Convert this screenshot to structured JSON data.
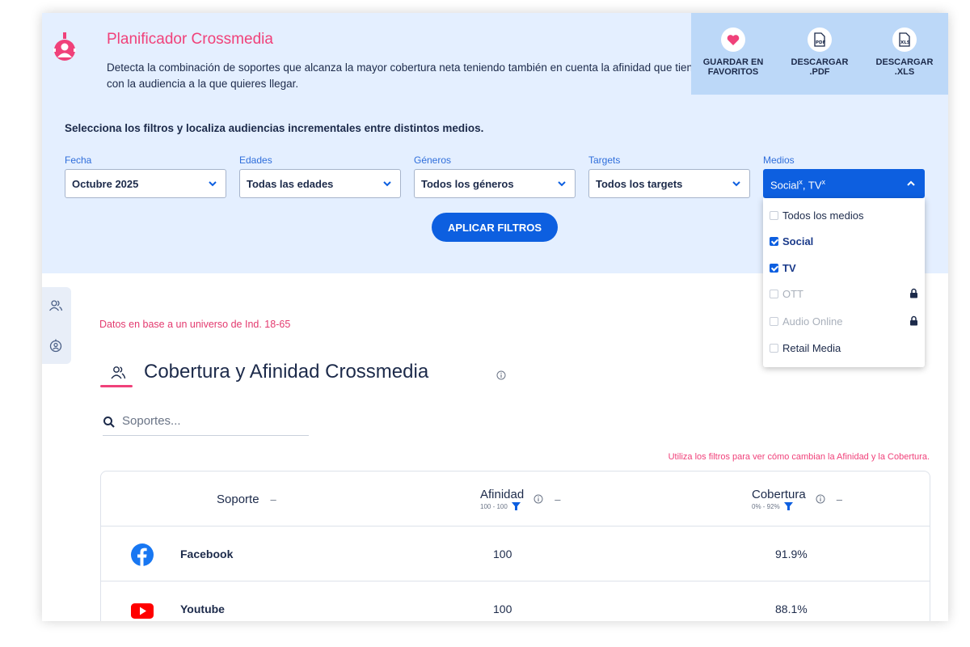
{
  "app": {
    "title": "Planificador Crossmedia",
    "description": "Detecta la combinación de soportes que alcanza la mayor cobertura neta teniendo también en cuenta la afinidad que tienen con la audiencia a la que quieres llegar."
  },
  "actions": [
    {
      "label1": "Guardar en",
      "label2": "favoritos",
      "icon": "heart-icon"
    },
    {
      "label1": "Descargar",
      "label2": ".PDF",
      "icon": "pdf-icon"
    },
    {
      "label1": "Descargar",
      "label2": ".XLS",
      "icon": "xls-icon"
    }
  ],
  "filters": {
    "heading": "Selecciona los filtros y localiza audiencias incrementales entre distintos medios.",
    "fecha": {
      "label": "Fecha",
      "value": "Octubre 2025"
    },
    "edades": {
      "label": "Edades",
      "value": "Todas las edades"
    },
    "generos": {
      "label": "Géneros",
      "value": "Todos los géneros"
    },
    "targets": {
      "label": "Targets",
      "value": "Todos los targets"
    },
    "medios": {
      "label": "Medios",
      "selected1": "Social",
      "selected2": "TV",
      "remove": "x"
    },
    "apply_label": "Aplicar filtros"
  },
  "medios_options": [
    {
      "label": "Todos los medios",
      "checked": false,
      "locked": false
    },
    {
      "label": "Social",
      "checked": true,
      "locked": false
    },
    {
      "label": "TV",
      "checked": true,
      "locked": false
    },
    {
      "label": "OTT",
      "checked": false,
      "locked": true
    },
    {
      "label": "Audio Online",
      "checked": false,
      "locked": true
    },
    {
      "label": "Retail Media",
      "checked": false,
      "locked": false
    }
  ],
  "universe_note": "Datos en base a un universo de Ind. 18-65",
  "section": {
    "title": "Cobertura y Afinidad Crossmedia",
    "search_placeholder": "Soportes...",
    "hint": "Utiliza los filtros para ver cómo cambian la Afinidad y la Cobertura."
  },
  "table": {
    "headers": {
      "soporte": "Soporte",
      "afinidad": "Afinidad",
      "afinidad_range": "100 - 100",
      "cobertura": "Cobertura",
      "cobertura_range": "0% - 92%",
      "dash": "–"
    },
    "rows": [
      {
        "name": "Facebook",
        "afinidad": "100",
        "cobertura": "91.9%",
        "icon": "facebook-icon"
      },
      {
        "name": "Youtube",
        "afinidad": "100",
        "cobertura": "88.1%",
        "icon": "youtube-icon"
      }
    ]
  },
  "colors": {
    "brand_pink": "#f0417a",
    "primary_blue": "#0d5fe0",
    "hero_bg": "#e4efff",
    "actions_bg": "#bcd8f8"
  }
}
